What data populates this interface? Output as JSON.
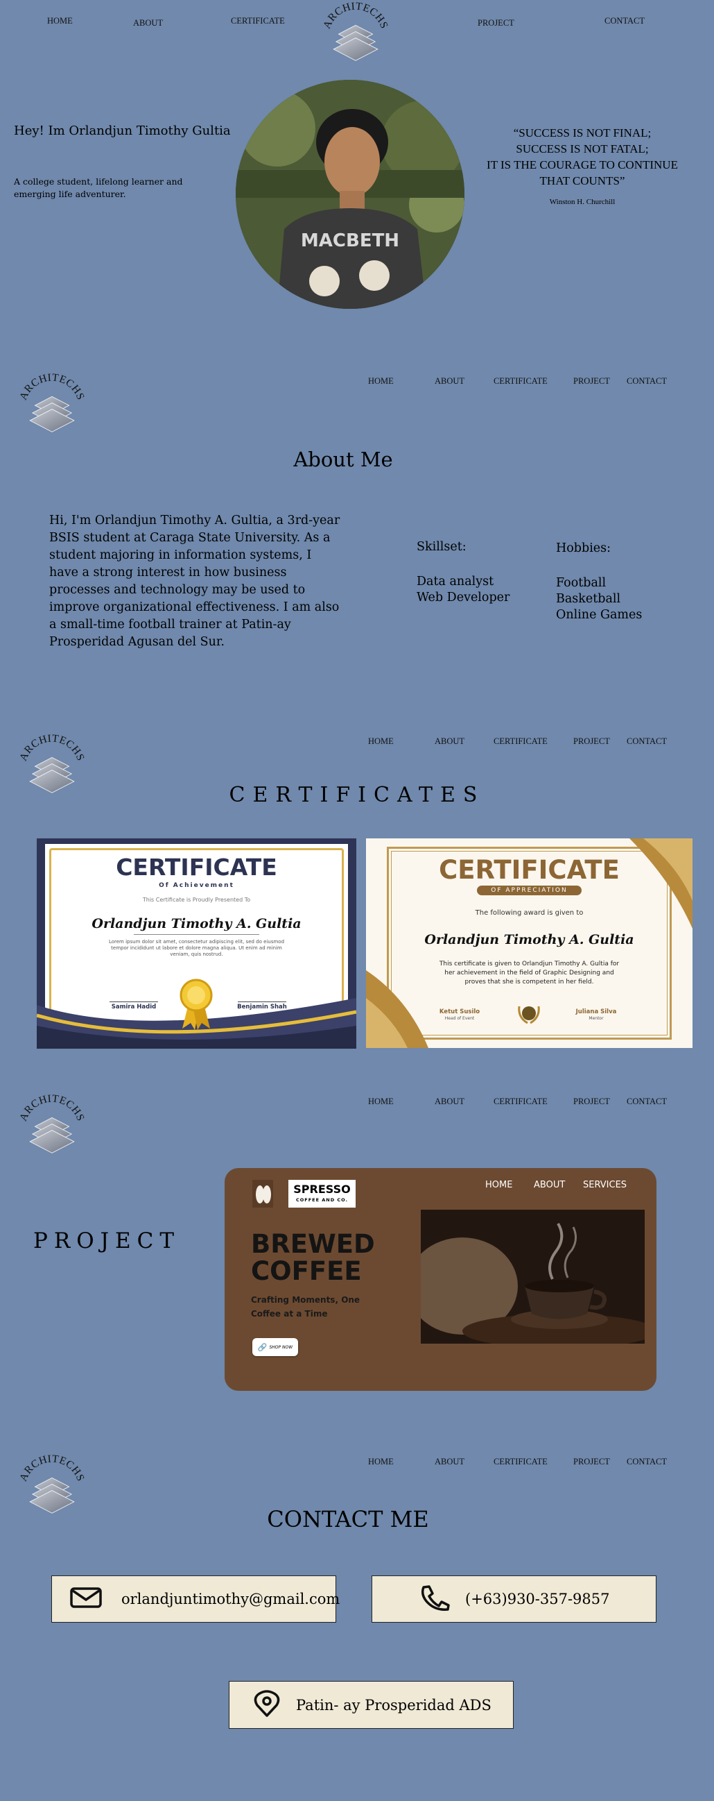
{
  "nav": {
    "home": "HOME",
    "about": "ABOUT",
    "certificate": "CERTIFICATE",
    "project": "PROJECT",
    "contact": "CONTACT"
  },
  "logo_text": "ARCHITECHS",
  "hero": {
    "greeting": "Hey! Im Orlandjun Timothy Gultia",
    "tagline": "A college student, lifelong learner    and emerging life adventurer.",
    "quote_lines": [
      "“SUCCESS IS NOT FINAL;",
      "SUCCESS IS NOT FATAL;",
      "IT IS THE COURAGE TO CONTINUE",
      "THAT COUNTS”"
    ],
    "quote_author": "Winston H. Churchill"
  },
  "about": {
    "title": "About Me",
    "body": "Hi, I'm Orlandjun Timothy A. Gultia, a 3rd-year BSIS student at Caraga State University. As a student majoring in information systems, I have a strong interest in how business processes and technology may be used to improve organizational effectiveness. I am also a small-time football trainer at Patin-ay Prosperidad Agusan del Sur.",
    "skillset_heading": "Skillset:",
    "skills": [
      "Data analyst",
      "Web Developer"
    ],
    "hobbies_heading": "Hobbies:",
    "hobbies": [
      "Football",
      "Basketball",
      "Online Games"
    ]
  },
  "certificates": {
    "title": "CERTIFICATES",
    "cert1": {
      "heading": "CERTIFICATE",
      "subheading": "Of Achievement",
      "presented": "This Certificate is Proudly Presented To",
      "name": "Orlandjun Timothy A. Gultia",
      "body": "Lorem ipsum dolor sit amet, consectetur adipiscing elit, sed do eiusmod tempor incididunt ut labore et dolore magna aliqua. Ut enim ad minim veniam, quis nostrud.",
      "sig_left": "Samira Hadid",
      "sig_right": "Benjamin Shah"
    },
    "cert2": {
      "heading": "CERTIFICATE",
      "subheading": "OF APPRECIATION",
      "given": "The following award is given to",
      "name": "Orlandjun Timothy A. Gultia",
      "body": "This certificate is given to Orlandjun Timothy A. Gultia for her achievement in the field of Graphic Designing and proves that she is competent in her field.",
      "sig_left": "Ketut Susilo",
      "sig_left_role": "Head of Event",
      "sig_right": "Juliana Silva",
      "sig_right_role": "Mentor"
    }
  },
  "project": {
    "title": "PROJECT",
    "brand": "SPRESSO",
    "brand_sub": "COFFEE AND CO.",
    "nav": [
      "HOME",
      "ABOUT",
      "SERVICES"
    ],
    "headline_1": "BREWED",
    "headline_2": "COFFEE",
    "tagline": "Crafting Moments, One Coffee at a Time",
    "button": "SHOP NOW"
  },
  "contact": {
    "title": "CONTACT ME",
    "email": "orlandjuntimothy@gmail.com",
    "phone": "(+63)930-357-9857",
    "address": "Patin- ay Prosperidad ADS"
  }
}
